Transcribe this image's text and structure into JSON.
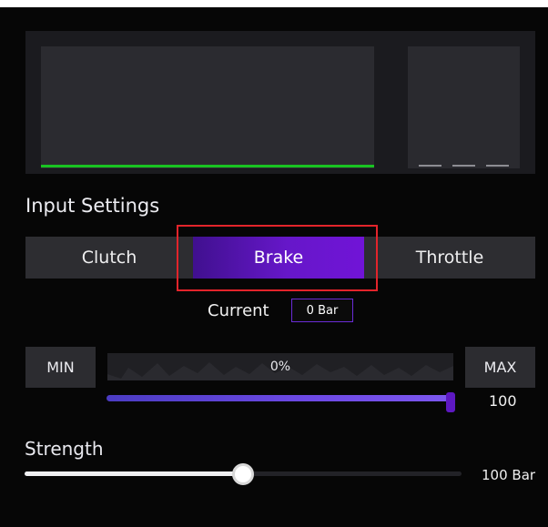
{
  "section": {
    "title": "Input Settings"
  },
  "tabs": [
    {
      "label": "Clutch",
      "selected": false
    },
    {
      "label": "Brake",
      "selected": true
    },
    {
      "label": "Throttle",
      "selected": false
    }
  ],
  "current": {
    "label": "Current",
    "value": "0 Bar"
  },
  "range": {
    "min_label": "MIN",
    "max_label": "MAX",
    "value_text": "0%",
    "max_value": "100",
    "max_fraction": 1.0
  },
  "strength": {
    "title": "Strength",
    "value": "100 Bar",
    "fraction": 0.5
  },
  "colors": {
    "accent_purple": "#6617c9",
    "graph_line_green": "#19c322",
    "highlight_red": "#e3242b"
  },
  "icons": {
    "range_handle": "slider-handle-icon",
    "strength_handle": "slider-knob-icon"
  }
}
